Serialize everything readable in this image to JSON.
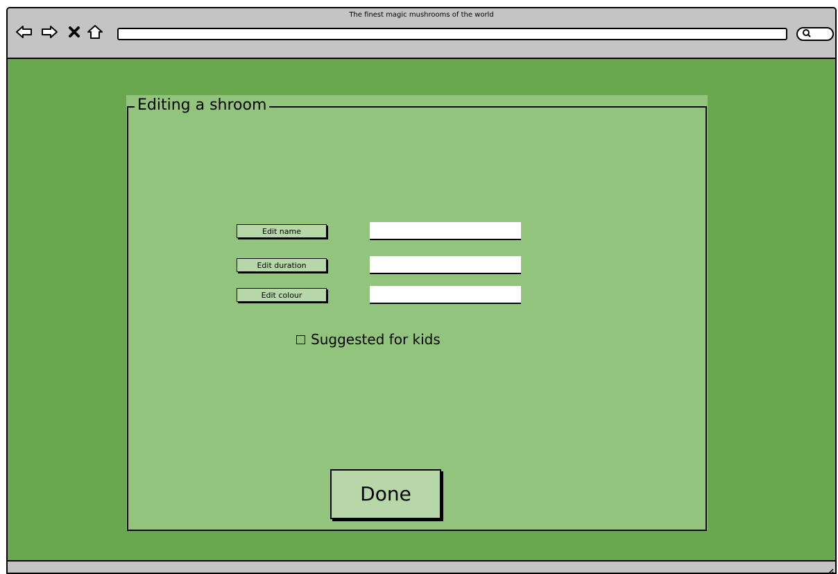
{
  "browser": {
    "title": "The finest magic mushrooms of the world",
    "address_value": "",
    "icons": [
      "back-arrow-icon",
      "forward-arrow-icon",
      "close-icon",
      "home-icon",
      "search-icon"
    ]
  },
  "form": {
    "legend": "Editing a shroom",
    "fields": [
      {
        "button_label": "Edit name",
        "value": ""
      },
      {
        "button_label": "Edit duration",
        "value": ""
      },
      {
        "button_label": "Edit colour",
        "value": ""
      }
    ],
    "checkbox_label": "Suggested for kids",
    "checkbox_checked": false,
    "done_label": "Done"
  },
  "colors": {
    "page_background": "#69a84f",
    "panel_background": "#93c47d",
    "button_background": "#b6d7a8",
    "chrome": "#c4c4c4"
  }
}
